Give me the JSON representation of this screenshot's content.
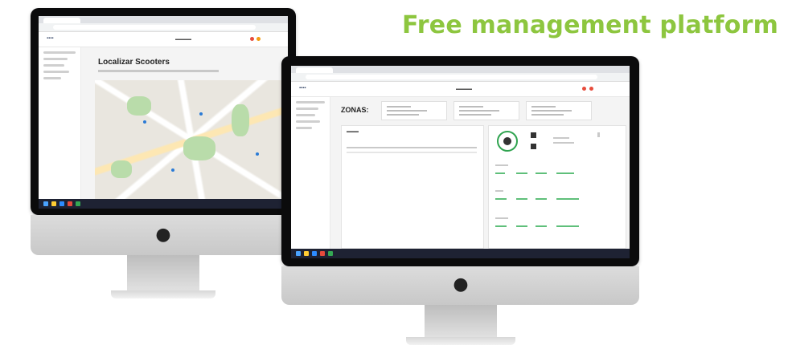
{
  "headline": "Free management platform",
  "colors": {
    "accent": "#8dc63f",
    "brand_green": "#2fa34f"
  },
  "left_monitor": {
    "page_heading": "Localizar Scooters",
    "apple_logo": "apple-logo-icon"
  },
  "right_monitor": {
    "section_heading": "ZONAS:",
    "apple_logo": "apple-logo-icon"
  }
}
